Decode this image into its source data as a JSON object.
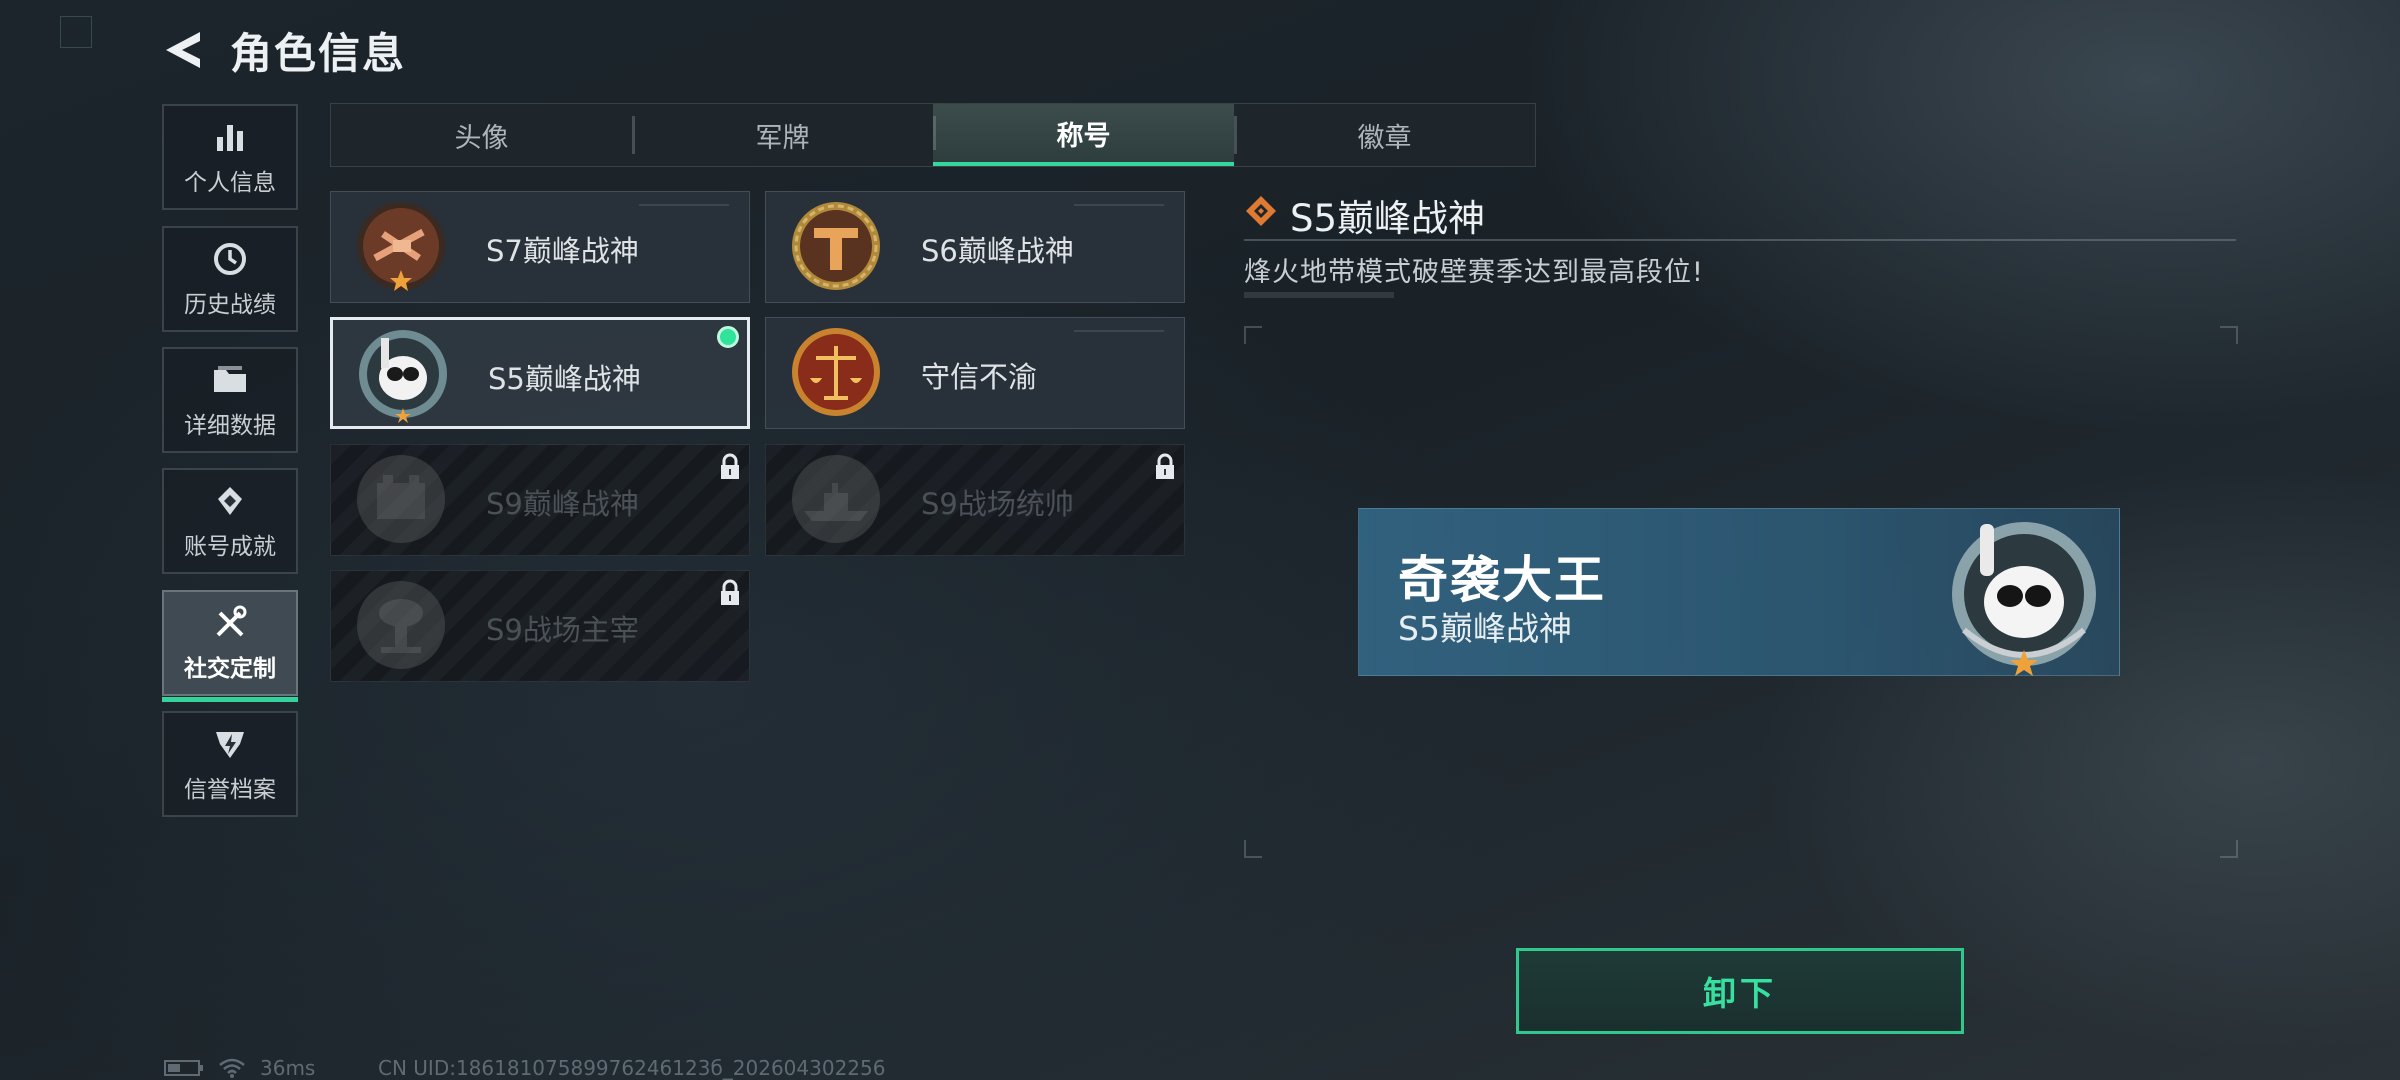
{
  "header": {
    "title": "角色信息"
  },
  "sidebar": {
    "items": [
      {
        "label": "个人信息",
        "icon": "bar-chart-icon",
        "active": false
      },
      {
        "label": "历史战绩",
        "icon": "clock-icon",
        "active": false
      },
      {
        "label": "详细数据",
        "icon": "folder-icon",
        "active": false
      },
      {
        "label": "账号成就",
        "icon": "achievement-icon",
        "active": false
      },
      {
        "label": "社交定制",
        "icon": "tools-icon",
        "active": true
      },
      {
        "label": "信誉档案",
        "icon": "shield-icon",
        "active": false
      }
    ]
  },
  "tabs": [
    {
      "label": "头像",
      "active": false
    },
    {
      "label": "军牌",
      "active": false
    },
    {
      "label": "称号",
      "active": true
    },
    {
      "label": "徽章",
      "active": false
    }
  ],
  "titles": [
    {
      "name": "S7巅峰战神",
      "state": "unlocked",
      "emblem": "crossbow-emblem-icon"
    },
    {
      "name": "S6巅峰战神",
      "state": "unlocked",
      "emblem": "helmet-emblem-icon"
    },
    {
      "name": "S5巅峰战神",
      "state": "selected-equipped",
      "emblem": "diver-skull-emblem-icon"
    },
    {
      "name": "守信不渝",
      "state": "unlocked",
      "emblem": "scales-emblem-icon"
    },
    {
      "name": "S9巅峰战神",
      "state": "locked",
      "emblem": "fortress-emblem-icon"
    },
    {
      "name": "S9战场统帅",
      "state": "locked",
      "emblem": "warship-emblem-icon"
    },
    {
      "name": "S9战场主宰",
      "state": "locked",
      "emblem": "mushroom-cloud-emblem-icon"
    }
  ],
  "detail": {
    "title": "S5巅峰战神",
    "description": "烽火地带模式破壁赛季达到最高段位!"
  },
  "nameplate": {
    "player_name": "奇袭大王",
    "title": "S5巅峰战神"
  },
  "actions": {
    "unequip_label": "卸下"
  },
  "status": {
    "ping": "36ms",
    "uid": "CN UID:18618107589976246123б_202604302256"
  },
  "colors": {
    "accent": "#34d39a",
    "nameplate": "#2f6482",
    "emblem_orange": "#e08a3a"
  }
}
